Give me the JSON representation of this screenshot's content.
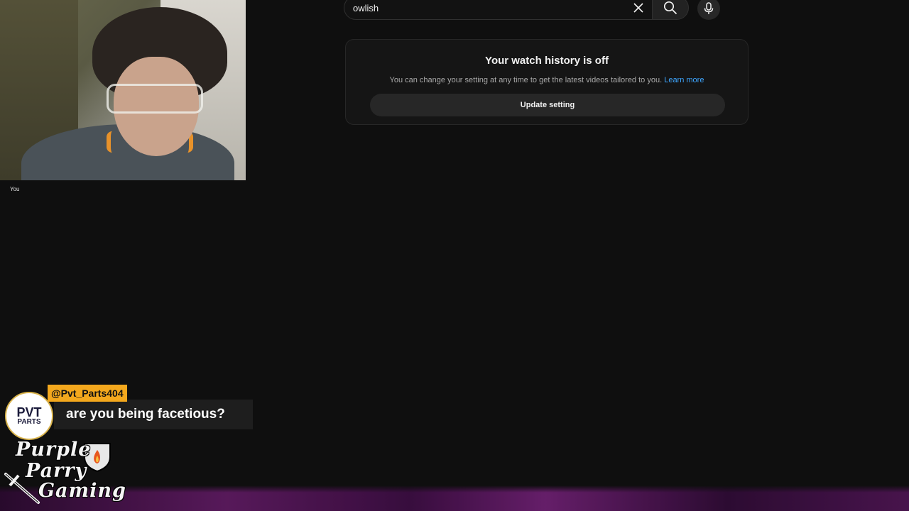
{
  "webcam": {
    "label": "You"
  },
  "search": {
    "value": "owlish",
    "clear_icon": "close-icon",
    "search_icon": "search-icon",
    "mic_icon": "microphone-icon"
  },
  "history_card": {
    "title": "Your watch history is off",
    "description": "You can change your setting at any time to get the latest videos tailored to you.",
    "link": "Learn more",
    "button": "Update setting"
  },
  "chat": {
    "username": "@Pvt_Parts404",
    "message": "are you being facetious?",
    "avatar_line1": "PVT",
    "avatar_line2": "PARTS"
  },
  "logo": {
    "line1": "Purple",
    "line2": "Parry",
    "line3": "Gaming"
  },
  "colors": {
    "background": "#0f0f0f",
    "link": "#3ea6ff",
    "chat_tag": "#f4a81d",
    "glow": "#5b1a5e"
  }
}
